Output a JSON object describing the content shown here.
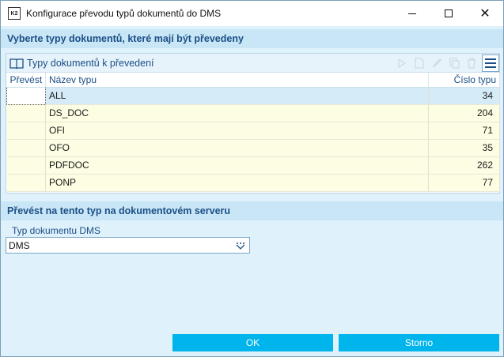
{
  "window": {
    "app_icon_text": "K2",
    "title": "Konfigurace převodu typů dokumentů do DMS",
    "icons": {
      "minimize": "minimize-icon",
      "maximize": "maximize-icon",
      "close": "close-icon"
    }
  },
  "section1": {
    "title": "Vyberte typy dokumentů, které mají být převedeny"
  },
  "grid": {
    "toolbar_title": "Typy dokumentů k převedení",
    "toolbar_icons": [
      "book-icon",
      "play-icon",
      "new-document-icon",
      "edit-pencil-icon",
      "copy-icon",
      "delete-trash-icon",
      "hamburger-menu-icon"
    ],
    "columns": [
      "Převést",
      "Název typu",
      "Číslo typu"
    ],
    "rows": [
      {
        "convert": "",
        "name": "ALL",
        "number": "34"
      },
      {
        "convert": "",
        "name": "DS_DOC",
        "number": "204"
      },
      {
        "convert": "",
        "name": "OFI",
        "number": "71"
      },
      {
        "convert": "",
        "name": "OFO",
        "number": "35"
      },
      {
        "convert": "",
        "name": "PDFDOC",
        "number": "262"
      },
      {
        "convert": "",
        "name": "PONP",
        "number": "77"
      }
    ]
  },
  "section2": {
    "title": "Převést na tento typ na dokumentovém serveru"
  },
  "dms_field": {
    "label": "Typ dokumentu DMS",
    "value": "DMS"
  },
  "buttons": {
    "ok": "OK",
    "storno": "Storno"
  },
  "colors": {
    "accent": "#00b4ec",
    "header_text": "#1b4f86",
    "background": "#dff1fb",
    "row_bg": "#fdfde3",
    "selected_row": "#d6ebf8"
  }
}
